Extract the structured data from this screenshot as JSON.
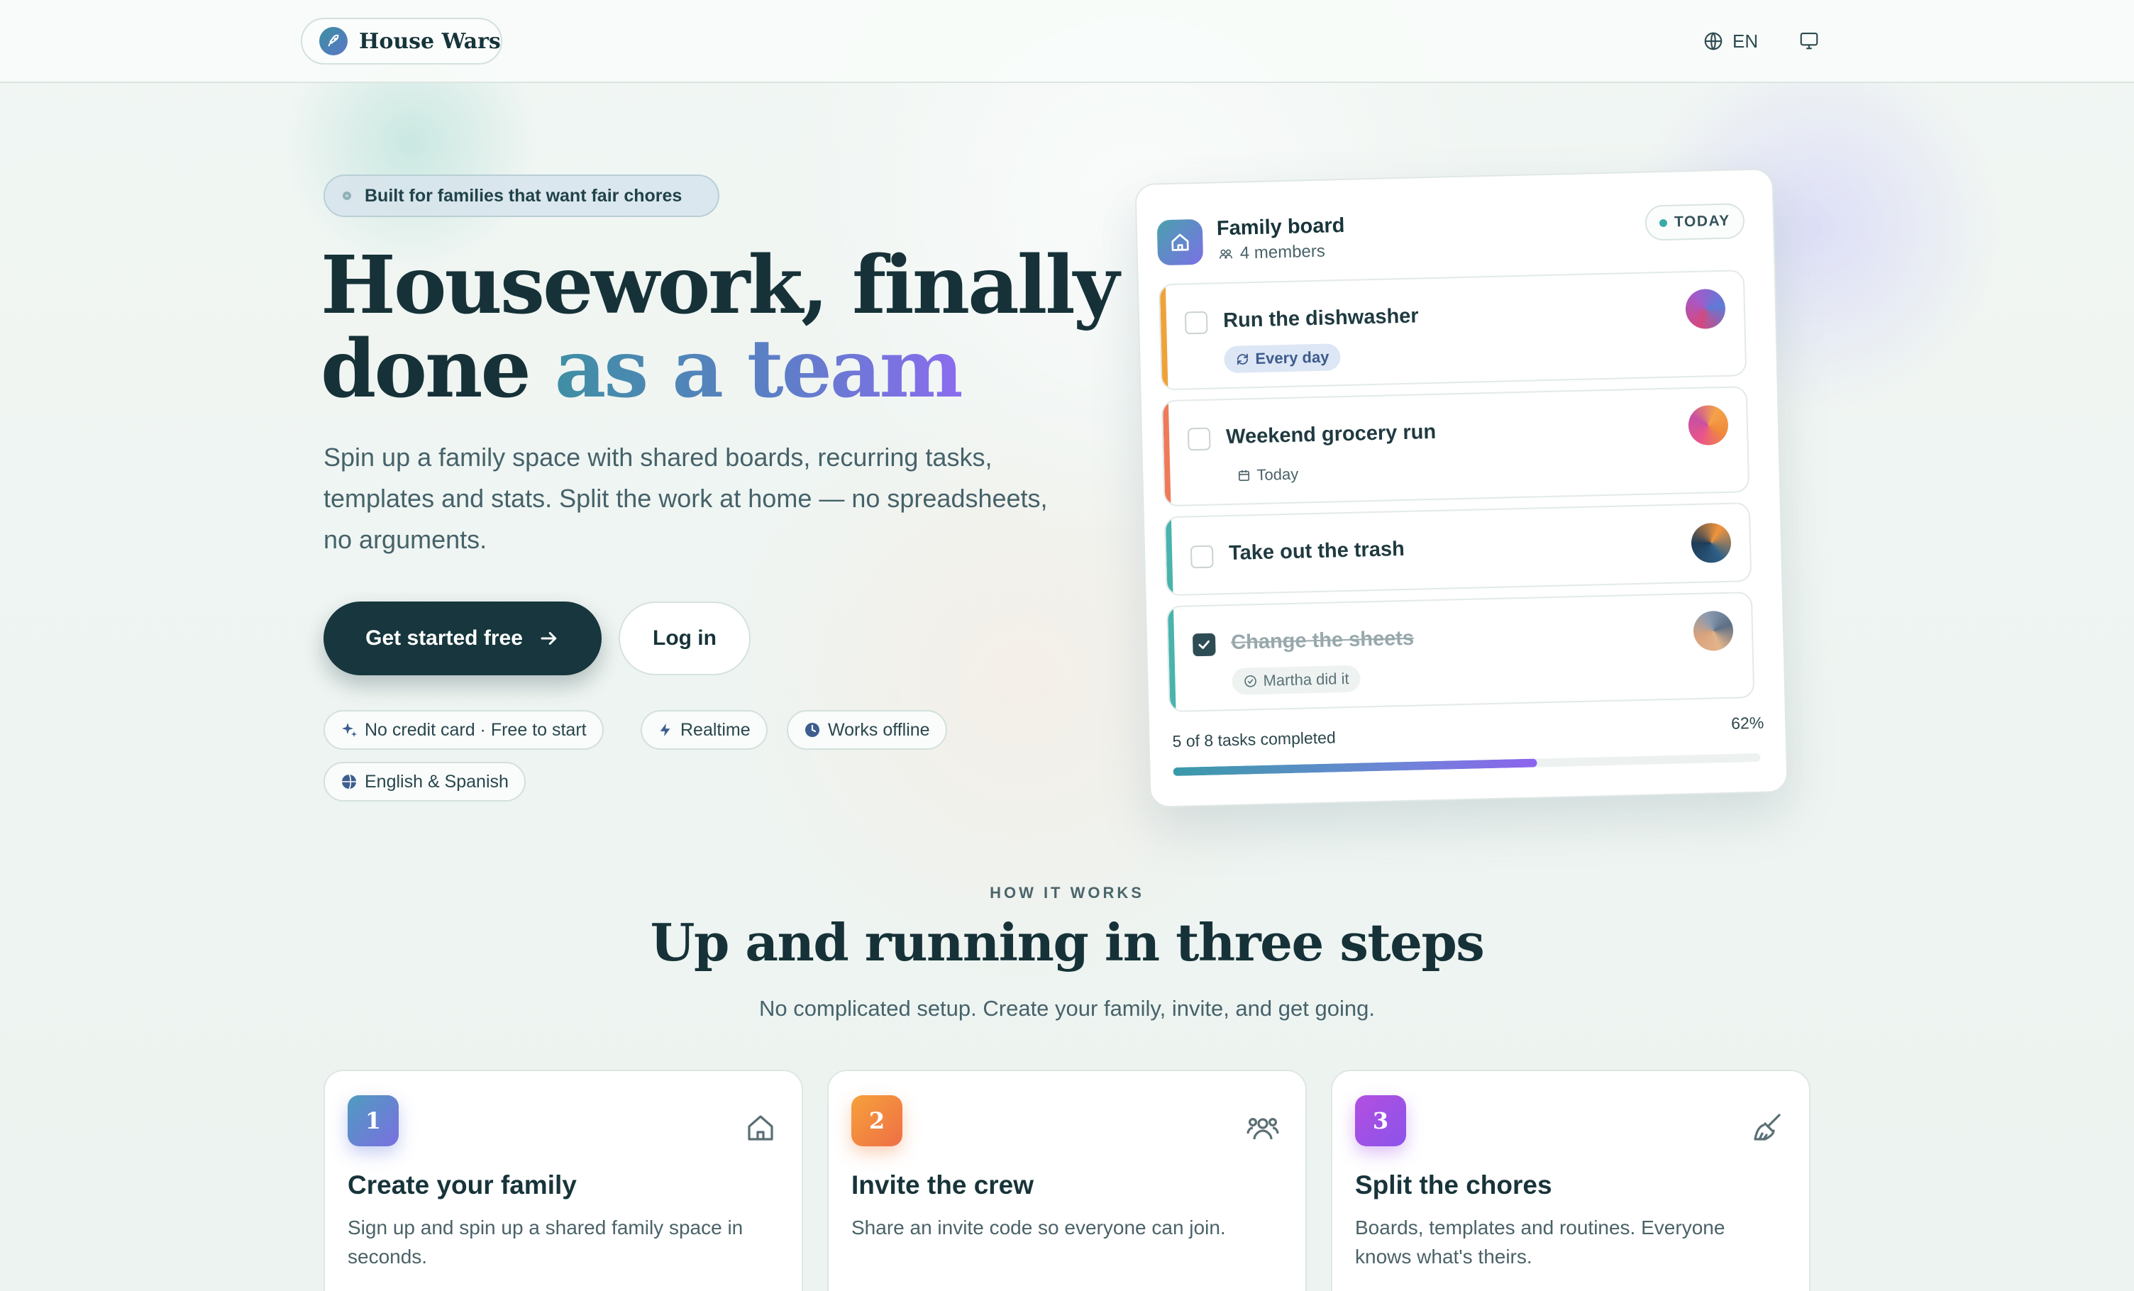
{
  "nav": {
    "brand": "House Wars",
    "language": "EN"
  },
  "hero": {
    "badge": "Built for families that want fair chores",
    "title_line1": "Housework, finally",
    "title_line2_plain": "done ",
    "title_line2_accent": "as a team",
    "subtitle": "Spin up a family space with shared boards, recurring tasks, templates and stats. Split the work at home — no spreadsheets, no arguments.",
    "primary_button": "Get started free",
    "secondary_button": "Log in",
    "chips": [
      {
        "label": "No credit card · Free to start",
        "icon": "sparkle-icon"
      },
      {
        "label": "Realtime",
        "icon": "bolt-icon"
      },
      {
        "label": "Works offline",
        "icon": "clock-icon"
      },
      {
        "label": "English & Spanish",
        "icon": "globe-icon"
      }
    ]
  },
  "board": {
    "title": "Family board",
    "members": "4 members",
    "badge": "TODAY",
    "tasks": [
      {
        "name": "Run the dishwasher",
        "tag": "Every day",
        "tag_icon": "repeat-icon",
        "done": false,
        "stripe": "#f0a23a"
      },
      {
        "name": "Weekend grocery run",
        "tag": "Today",
        "tag_icon": "calendar-icon",
        "done": false,
        "stripe": "#ef7a5a"
      },
      {
        "name": "Take out the trash",
        "tag": "",
        "tag_icon": "",
        "done": false,
        "stripe": "#49b3ad"
      },
      {
        "name": "Change the sheets",
        "tag": "Martha did it",
        "tag_icon": "check-circle-icon",
        "done": true,
        "stripe": "#49b3ad"
      }
    ],
    "progress_label": "5 of 8 tasks completed",
    "progress_percent": "62%",
    "progress_value": 0.62
  },
  "how": {
    "eyebrow": "HOW IT WORKS",
    "title": "Up and running in three steps",
    "subtitle": "No complicated setup. Create your family, invite, and get going.",
    "steps": [
      {
        "num": "1",
        "title": "Create your family",
        "desc": "Sign up and spin up a shared family space in seconds.",
        "icon": "home-icon"
      },
      {
        "num": "2",
        "title": "Invite the crew",
        "desc": "Share an invite code so everyone can join.",
        "icon": "users-icon"
      },
      {
        "num": "3",
        "title": "Split the chores",
        "desc": "Boards, templates and routines. Everyone knows what's theirs.",
        "icon": "broom-icon"
      }
    ]
  },
  "colors": {
    "primary": "#17363d",
    "accent_teal": "#3f8fa4",
    "accent_violet": "#8b6cef"
  }
}
